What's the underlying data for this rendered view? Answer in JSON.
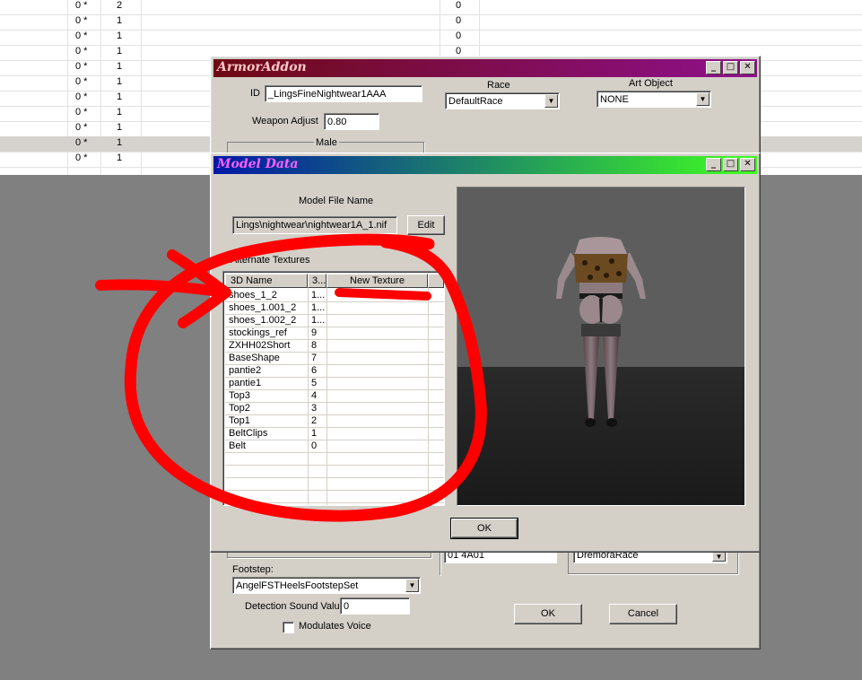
{
  "background_grid": {
    "rows": [
      {
        "c1": "0 *",
        "c2": "2",
        "c3": "0"
      },
      {
        "c1": "0 *",
        "c2": "1",
        "c3": "0"
      },
      {
        "c1": "0 *",
        "c2": "1",
        "c3": "0"
      },
      {
        "c1": "0 *",
        "c2": "1",
        "c3": "0"
      },
      {
        "c1": "0 *",
        "c2": "1",
        "c3": ""
      },
      {
        "c1": "0 *",
        "c2": "1",
        "c3": ""
      },
      {
        "c1": "0 *",
        "c2": "1",
        "c3": ""
      },
      {
        "c1": "0 *",
        "c2": "1",
        "c3": ""
      },
      {
        "c1": "0 *",
        "c2": "1",
        "c3": ""
      },
      {
        "c1": "0 *",
        "c2": "1",
        "c3": ""
      },
      {
        "c1": "0 *",
        "c2": "1",
        "c3": ""
      }
    ]
  },
  "armor_addon": {
    "title": "ArmorAddon",
    "id_label": "ID",
    "id_value": "_LingsFineNightwear1AAA",
    "race_label": "Race",
    "race_value": "DefaultRace",
    "art_object_label": "Art Object",
    "art_object_value": "NONE",
    "weapon_adjust_label": "Weapon Adjust",
    "weapon_adjust_value": "0.80",
    "male_label": "Male",
    "partial_field_left": "01 4A01",
    "partial_field_right": "DremoraRace",
    "footstep_label": "Footstep:",
    "footstep_value": "AngelFSTHeelsFootstepSet",
    "detection_label": "Detection Sound Value",
    "detection_value": "0",
    "modulates_label": "Modulates Voice",
    "ok_label": "OK",
    "cancel_label": "Cancel"
  },
  "model_data": {
    "title": "Model Data",
    "model_file_label": "Model File Name",
    "model_file_value": "Lings\\nightwear\\nightwear1A_1.nif",
    "edit_label": "Edit",
    "alt_textures_label": "Alternate Textures",
    "columns": [
      "3D Name",
      "3...",
      "New Texture"
    ],
    "rows": [
      {
        "name": "shoes_1_2",
        "idx": "1...",
        "tex": ""
      },
      {
        "name": "shoes_1.001_2",
        "idx": "1...",
        "tex": ""
      },
      {
        "name": "shoes_1.002_2",
        "idx": "1...",
        "tex": ""
      },
      {
        "name": "stockings_ref",
        "idx": "9",
        "tex": ""
      },
      {
        "name": "ZXHH02Short",
        "idx": "8",
        "tex": ""
      },
      {
        "name": "BaseShape",
        "idx": "7",
        "tex": ""
      },
      {
        "name": "pantie2",
        "idx": "6",
        "tex": ""
      },
      {
        "name": "pantie1",
        "idx": "5",
        "tex": ""
      },
      {
        "name": "Top3",
        "idx": "4",
        "tex": ""
      },
      {
        "name": "Top2",
        "idx": "3",
        "tex": ""
      },
      {
        "name": "Top1",
        "idx": "2",
        "tex": ""
      },
      {
        "name": "BeltClips",
        "idx": "1",
        "tex": ""
      },
      {
        "name": "Belt",
        "idx": "0",
        "tex": ""
      }
    ],
    "ok_label": "OK"
  },
  "colors": {
    "armor_title_gradient": [
      "#6e0a14",
      "#90108c"
    ],
    "model_title_gradient": [
      "#0018a8",
      "#40ff20"
    ],
    "title_text_armor": "#ffc8c8",
    "title_text_model": "#ff60ff",
    "annotation": "#ff0000"
  },
  "icons": {
    "minimize": "minimize-icon",
    "maximize": "maximize-icon",
    "close": "close-icon",
    "dropdown": "chevron-down-icon"
  }
}
